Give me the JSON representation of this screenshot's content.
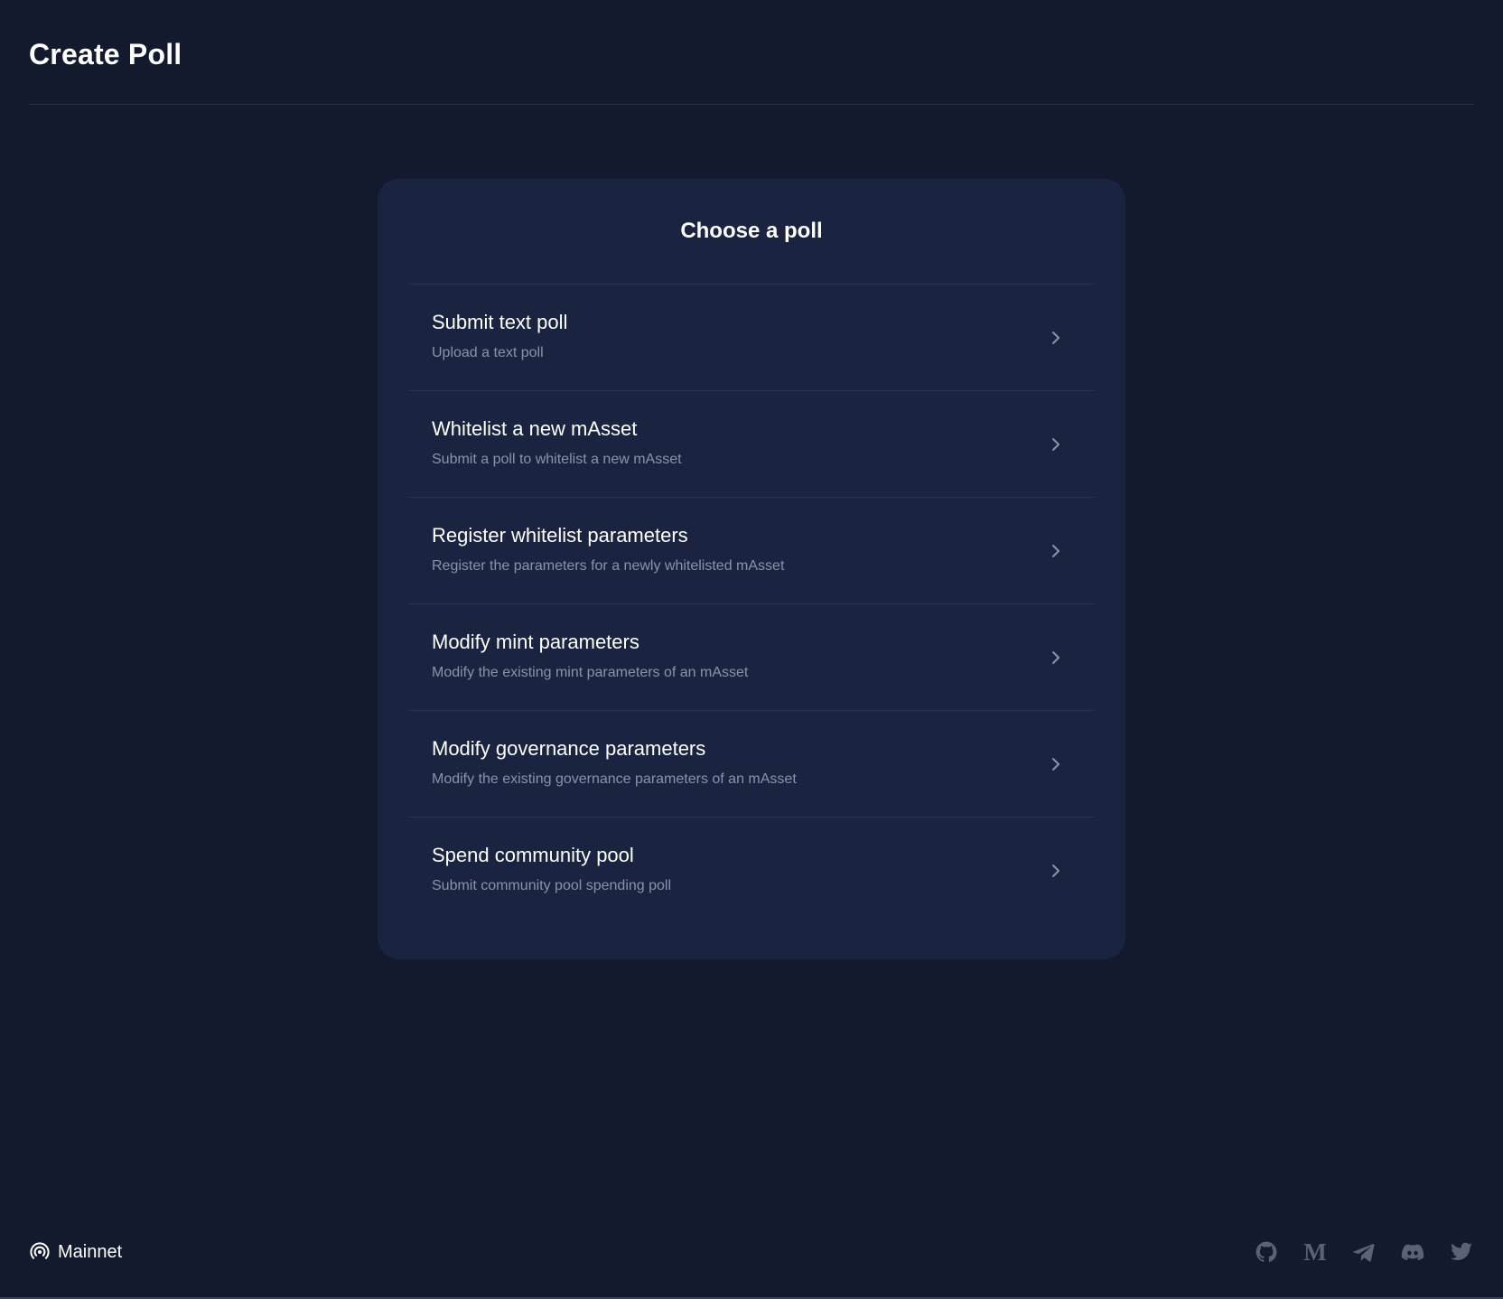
{
  "header": {
    "title": "Create Poll"
  },
  "card": {
    "title": "Choose a poll",
    "items": [
      {
        "title": "Submit text poll",
        "description": "Upload a text poll"
      },
      {
        "title": "Whitelist a new mAsset",
        "description": "Submit a poll to whitelist a new mAsset"
      },
      {
        "title": "Register whitelist parameters",
        "description": "Register the parameters for a newly whitelisted mAsset"
      },
      {
        "title": "Modify mint parameters",
        "description": "Modify the existing mint parameters of an mAsset"
      },
      {
        "title": "Modify governance parameters",
        "description": "Modify the existing governance parameters of an mAsset"
      },
      {
        "title": "Spend community pool",
        "description": "Submit community pool spending poll"
      }
    ]
  },
  "footer": {
    "network_label": "Mainnet",
    "network_icon": "broadcast-icon",
    "medium_glyph": "M",
    "socials": [
      "github-icon",
      "medium-icon",
      "telegram-icon",
      "discord-icon",
      "twitter-icon"
    ]
  },
  "colors": {
    "background": "#131a2e",
    "card": "#1a2440",
    "divider": "#2a3350",
    "muted_text": "#8a93ab",
    "icon": "#5b6276"
  }
}
